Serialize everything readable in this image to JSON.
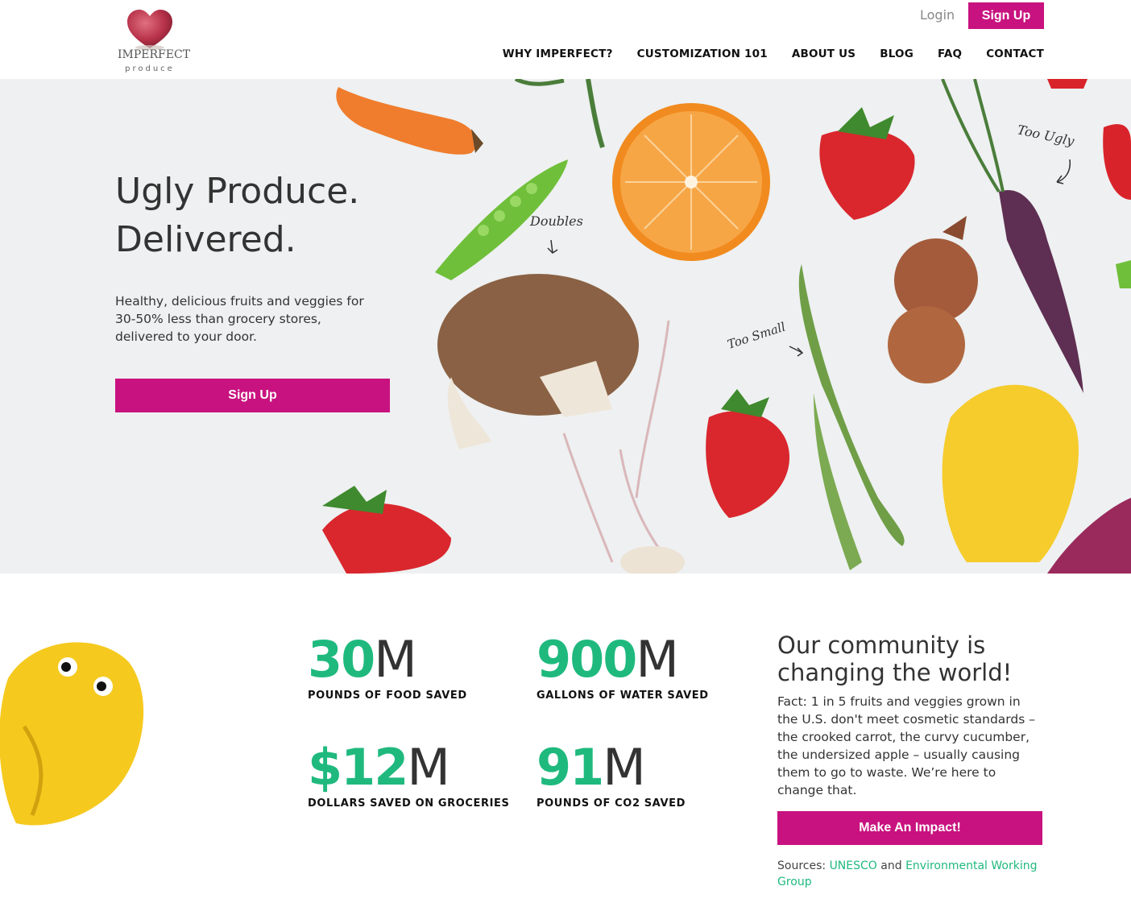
{
  "header": {
    "logo_word": "IMPERFECT",
    "logo_sub": "produce",
    "login_label": "Login",
    "signup_label": "Sign Up",
    "nav": [
      {
        "label": "WHY IMPERFECT?"
      },
      {
        "label": "CUSTOMIZATION 101"
      },
      {
        "label": "ABOUT US"
      },
      {
        "label": "BLOG"
      },
      {
        "label": "FAQ"
      },
      {
        "label": "CONTACT"
      }
    ]
  },
  "hero": {
    "title_line1": "Ugly Produce.",
    "title_line2": "Delivered.",
    "description": "Healthy, delicious fruits and veggies for 30-50% less than grocery stores, delivered to your door.",
    "cta_label": "Sign Up",
    "annotations": {
      "doubles": "Doubles",
      "too_small": "Too Small",
      "too_ugly": "Too Ugly"
    }
  },
  "stats": [
    {
      "highlight": "30",
      "suffix": "M",
      "label": "POUNDS OF FOOD SAVED"
    },
    {
      "highlight": "900",
      "suffix": "M",
      "label": "GALLONS OF WATER SAVED"
    },
    {
      "highlight": "$12",
      "suffix": "M",
      "label": "DOLLARS SAVED ON GROCERIES"
    },
    {
      "highlight": "91",
      "suffix": "M",
      "label": "POUNDS OF CO2 SAVED"
    }
  ],
  "community": {
    "heading": "Our community is changing the world!",
    "fact": "Fact: 1 in 5 fruits and veggies grown in the U.S. don't meet cosmetic standards – the crooked carrot, the curvy cucumber, the undersized apple – usually causing them to go to waste. We’re here to change that.",
    "cta_label": "Make An Impact!",
    "sources_prefix": "Sources:",
    "source1": "UNESCO",
    "sources_and": "and",
    "source2": "Environmental Working Group"
  },
  "colors": {
    "brand": "#c8127f",
    "accent_green": "#1fb97e"
  }
}
